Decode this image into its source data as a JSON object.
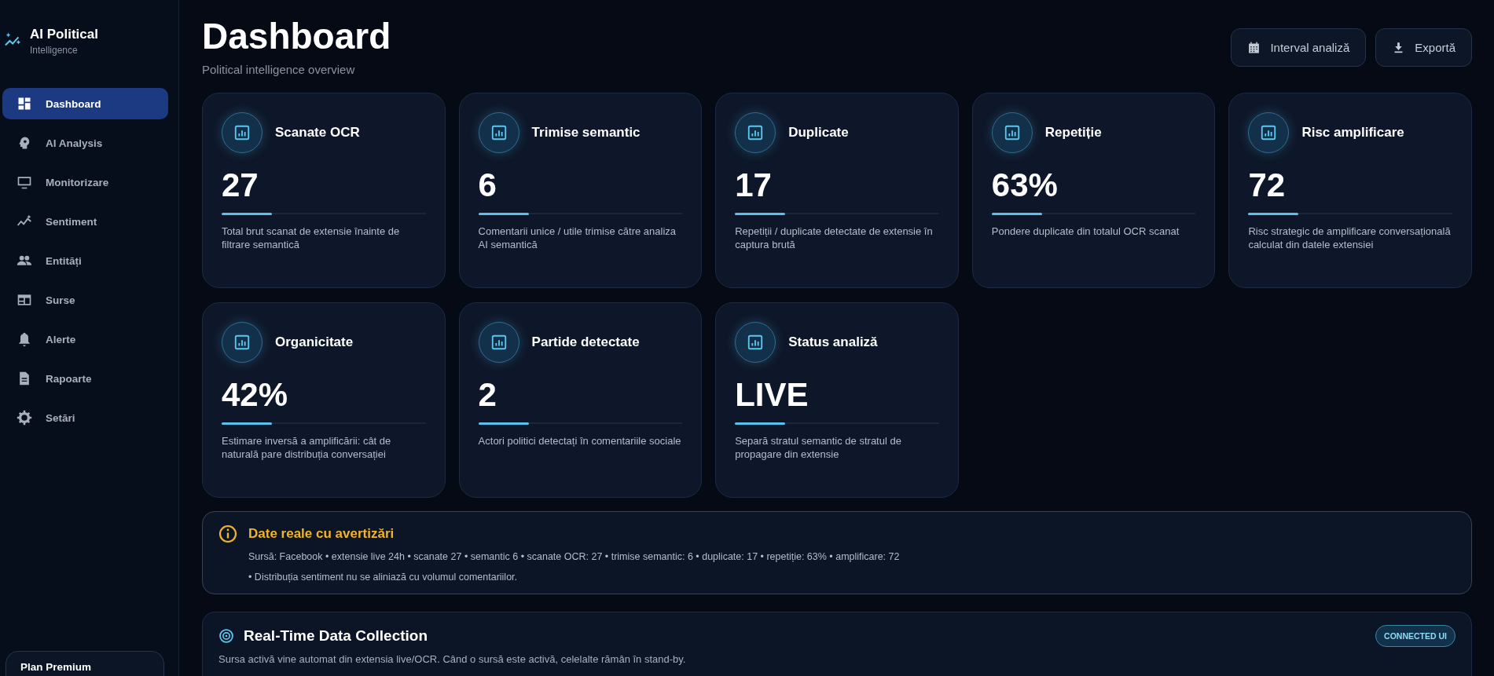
{
  "sidebar": {
    "brand": {
      "title": "AI Political",
      "subtitle": "Intelligence"
    },
    "items": [
      {
        "label": "Dashboard",
        "kind": "dashboard",
        "selected": true
      },
      {
        "label": "AI Analysis",
        "kind": "brain",
        "selected": false
      },
      {
        "label": "Monitorizare",
        "kind": "monitor",
        "selected": false
      },
      {
        "label": "Sentiment",
        "kind": "trend",
        "selected": false
      },
      {
        "label": "Entități",
        "kind": "people",
        "selected": false
      },
      {
        "label": "Surse",
        "kind": "table",
        "selected": false
      },
      {
        "label": "Alerte",
        "kind": "bell",
        "selected": false
      },
      {
        "label": "Rapoarte",
        "kind": "document",
        "selected": false
      },
      {
        "label": "Setări",
        "kind": "gear",
        "selected": false
      }
    ],
    "plan_card": {
      "title": "Plan Premium"
    }
  },
  "header": {
    "title": "Dashboard",
    "subtitle": "Political intelligence overview"
  },
  "actions": [
    {
      "label": "Interval analiză",
      "kind": "calendar"
    },
    {
      "label": "Exportă",
      "kind": "download"
    }
  ],
  "metrics": [
    {
      "title": "Scanate OCR",
      "value": "27",
      "description": "Total brut scanat de extensie înainte de filtrare semantică"
    },
    {
      "title": "Trimise semantic",
      "value": "6",
      "description": "Comentarii unice / utile trimise către analiza AI semantică"
    },
    {
      "title": "Duplicate",
      "value": "17",
      "description": "Repetiții / duplicate detectate de extensie în captura brută"
    },
    {
      "title": "Repetiție",
      "value": "63%",
      "description": "Pondere duplicate din totalul OCR scanat"
    },
    {
      "title": "Risc amplificare",
      "value": "72",
      "description": "Risc strategic de amplificare conversațională calculat din datele extensiei"
    },
    {
      "title": "Organicitate",
      "value": "42%",
      "description": "Estimare inversă a amplificării: cât de naturală pare distribuția conversației"
    },
    {
      "title": "Partide detectate",
      "value": "2",
      "description": "Actori politici detectați în comentariile sociale"
    },
    {
      "title": "Status analiză",
      "value": "LIVE",
      "description": "Separă stratul semantic de stratul de propagare din extensie"
    }
  ],
  "warning": {
    "title": "Date reale cu avertizări",
    "lines": [
      "Sursă: Facebook • extensie live 24h • scanate 27 • semantic 6 • scanate OCR: 27 • trimise semantic: 6 • duplicate: 17 • repetiție: 63% • amplificare: 72",
      "• Distribuția sentiment nu se aliniază cu volumul comentariilor."
    ]
  },
  "realtime": {
    "title": "Real-Time Data Collection",
    "badge": "CONNECTED UI",
    "description": "Sursa activă vine automat din extensia live/OCR. Când o sursă este activă, celelalte rămân în stand-by."
  }
}
